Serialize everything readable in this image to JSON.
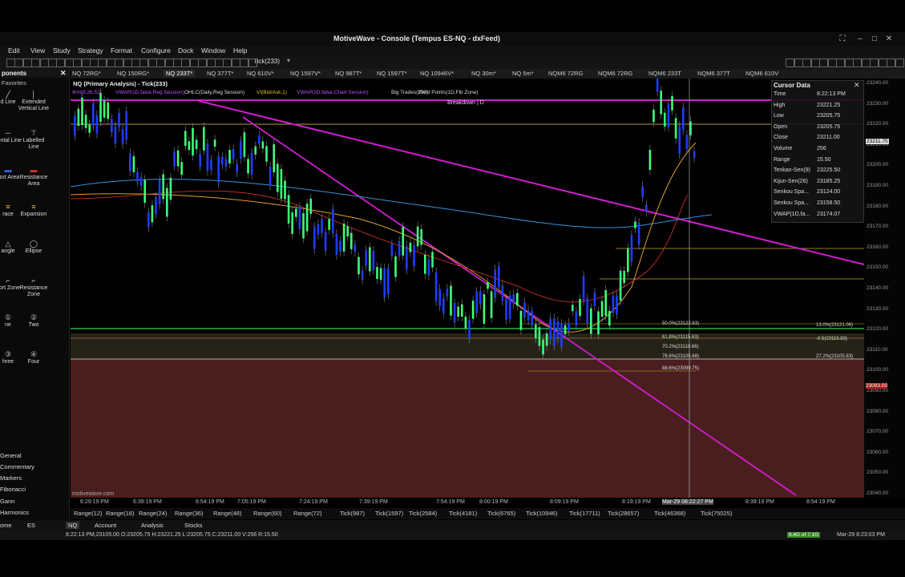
{
  "app": {
    "title": "MotiveWave - Console (Tempus ES-NQ - dxFeed)"
  },
  "menu": [
    "Edit",
    "View",
    "Study",
    "Strategy",
    "Format",
    "Configure",
    "Dock",
    "Window",
    "Help"
  ],
  "toolbar": {
    "bar_size": "Tick(233)"
  },
  "tabs": [
    {
      "label": "NQ 72RG*"
    },
    {
      "label": "NQ 150RG*"
    },
    {
      "label": "NQ 233T*",
      "active": true
    },
    {
      "label": "NQ 377T*"
    },
    {
      "label": "NQ 610V*"
    },
    {
      "label": "NQ 1597V*"
    },
    {
      "label": "NQ 987T*"
    },
    {
      "label": "NQ 1597T*"
    },
    {
      "label": "NQ 10946V*"
    },
    {
      "label": "NQ 30m*"
    },
    {
      "label": "NQ 5m*"
    },
    {
      "label": "NQM6 72RG"
    },
    {
      "label": "NQM6 72RG"
    },
    {
      "label": "NQM6 233T"
    },
    {
      "label": "NQM6 377T"
    },
    {
      "label": "NQM6 610V"
    }
  ],
  "left_panel": {
    "header": "ponents",
    "favorites": "Favorites",
    "components": [
      {
        "label": "d Line",
        "icon": "line-icon"
      },
      {
        "label": "Extended Vertical Line",
        "icon": "vline-icon"
      },
      {
        "label": "zontal Line",
        "icon": "hline-icon"
      },
      {
        "label": "Labelled Line",
        "icon": "label-line-icon"
      },
      {
        "label": "port Area",
        "icon": "support-area-icon"
      },
      {
        "label": "Resistance Area",
        "icon": "resistance-area-icon"
      },
      {
        "label": "race",
        "icon": "retrace-icon"
      },
      {
        "label": "Expansion",
        "icon": "expansion-icon"
      },
      {
        "label": "angle",
        "icon": "triangle-icon"
      },
      {
        "label": "Ellipse",
        "icon": "ellipse-icon"
      },
      {
        "label": "port Zone",
        "icon": "support-zone-icon"
      },
      {
        "label": "Resistance Zone",
        "icon": "resistance-zone-icon"
      },
      {
        "label": "ne",
        "icon": "one-icon"
      },
      {
        "label": "Two",
        "icon": "two-icon"
      },
      {
        "label": "hree",
        "icon": "three-icon"
      },
      {
        "label": "Four",
        "icon": "four-icon"
      }
    ],
    "nav": [
      "General",
      "Commentary",
      "Markers",
      "Fibonacci",
      "Gann",
      "Harmonics"
    ]
  },
  "chart": {
    "header": "NQ (Primary Analysis) - Tick(233)",
    "studies": [
      "IKH(9,26,52)",
      "VWAP(1D,false,Reg Session)",
      "OHLC(Daily,Reg Session)",
      "VI(Bid/Ask,1)",
      "VWAP(1D,false,Chart Session)",
      "Big Trades(250)",
      "Pivot Points(1D,Fib Zone)"
    ],
    "breakdown": "Breakdown | D",
    "watermark": "motivewave.com",
    "price_labels": [
      "23240.00",
      "23230.00",
      "23220.00",
      "23210.00",
      "23200.00",
      "23190.00",
      "23180.00",
      "23170.00",
      "23160.00",
      "23150.00",
      "23140.00",
      "23130.00",
      "23120.00",
      "23110.00",
      "23100.00",
      "23090.00",
      "23080.00",
      "23070.00",
      "23060.00",
      "23050.00",
      "23040.00"
    ],
    "last_price": "23211.75",
    "fib_right": [
      "13.0%(23121.06)",
      "-0.5(23115.83)",
      "27.2%(23105.83)"
    ],
    "red_price": "23093.00",
    "fib_left": [
      "50.0%(23122.63)",
      "61.8%(23115.63)",
      "70.2%(23110.66)",
      "78.6%(23105.68)",
      "88.6%(23099.75)"
    ],
    "time_labels": [
      "6:29:19 PM",
      "6:39:19 PM",
      "6:54:19 PM",
      "7:05:19 PM",
      "7:24:19 PM",
      "7:39:19 PM",
      "7:54:19 PM",
      "8:00:19 PM",
      "8:09:19 PM",
      "8:19:19 PM",
      "Mar-29 08:22:27 PM",
      "8:39:19 PM",
      "8:54:19 PM"
    ]
  },
  "cursor_data": {
    "title": "Cursor Data",
    "rows": [
      {
        "k": "Time",
        "v": "8:22:13 PM"
      },
      {
        "k": "High",
        "v": "23221.25"
      },
      {
        "k": "Low",
        "v": "23205.75"
      },
      {
        "k": "Open",
        "v": "23205.75"
      },
      {
        "k": "Close",
        "v": "23211.00"
      },
      {
        "k": "Volume",
        "v": "256"
      },
      {
        "k": "Range",
        "v": "15.50"
      },
      {
        "k": "Tenkan-Sen(9)",
        "v": "23225.50"
      },
      {
        "k": "Kijun-Sen(26)",
        "v": "23185.25"
      },
      {
        "k": "Senkou Spa...",
        "v": "23124.00"
      },
      {
        "k": "Senkou Spa...",
        "v": "23158.50"
      },
      {
        "k": "VWAP(1D,fa...",
        "v": "23174.07"
      }
    ]
  },
  "bar_types": [
    "Range(12)",
    "Range(18)",
    "Range(24)",
    "Range(36)",
    "Range(48)",
    "Range(60)",
    "Range(72)",
    "Tick(987)",
    "Tick(1597)",
    "Tick(2584)",
    "Tick(4181)",
    "Tick(6765)",
    "Tick(10946)",
    "Tick(17711)",
    "Tick(28657)",
    "Tick(46368)",
    "Tick(75025)"
  ],
  "bottom_tabs": [
    "ome",
    "ES",
    "NQ",
    "Account",
    "Analysis",
    "Stocks"
  ],
  "status": {
    "text": "8:22:13 PM,23105.00 O:23205.75 H:23221.25 L:23205.75 C:23211.00 V:256 R:15.50",
    "mem": "6.4G of 7.1G",
    "clock": "Mar-29 8:23:03 PM"
  },
  "colors": {
    "up": "#3dff7a",
    "down": "#1e3cff",
    "magenta": "#d21cd2",
    "zone": "#4a1e1e",
    "green_line": "#1fb84a"
  }
}
